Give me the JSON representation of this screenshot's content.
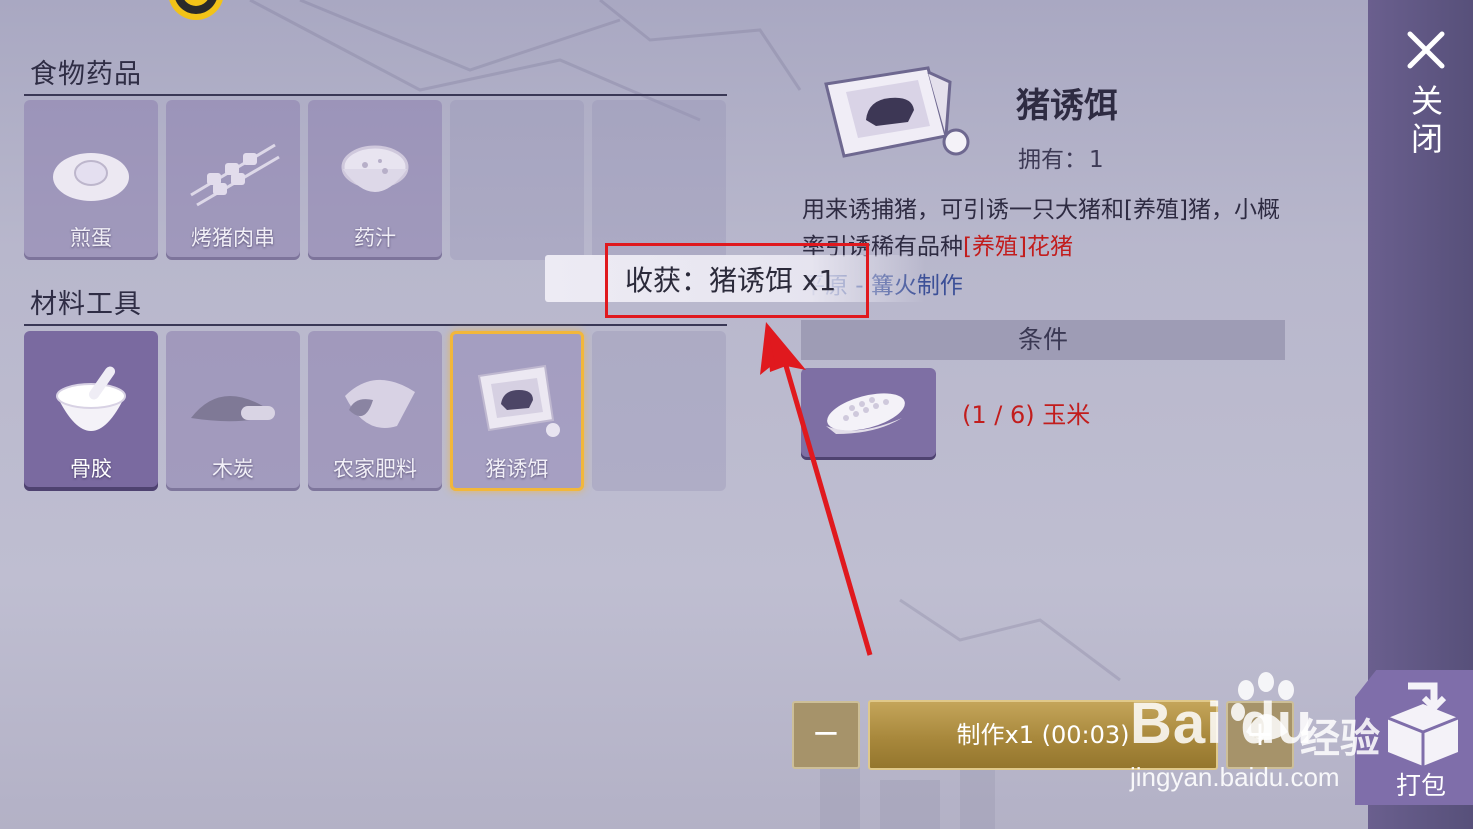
{
  "sections": [
    {
      "title": "食物药品",
      "items": [
        {
          "name": "煎蛋",
          "icon": "fried-egg-icon"
        },
        {
          "name": "烤猪肉串",
          "icon": "pork-skewer-icon"
        },
        {
          "name": "药汁",
          "icon": "soup-bowl-icon"
        },
        {
          "name": "",
          "icon": ""
        },
        {
          "name": "",
          "icon": ""
        }
      ]
    },
    {
      "title": "材料工具",
      "items": [
        {
          "name": "骨胶",
          "icon": "mortar-bowl-icon"
        },
        {
          "name": "木炭",
          "icon": "charcoal-pile-icon"
        },
        {
          "name": "农家肥料",
          "icon": "fertilizer-sack-icon"
        },
        {
          "name": "猪诱饵",
          "icon": "pig-bait-packet-icon",
          "selected": true
        },
        {
          "name": "",
          "icon": ""
        }
      ]
    }
  ],
  "detail": {
    "name": "猪诱饵",
    "owned_label": "拥有：",
    "owned_count": "1",
    "desc_part1": "用来诱捕猪，可引诱一只大猪和[养殖]猪，小概率引诱稀有品种",
    "desc_red": "[养殖]花猪",
    "source": "平原 - 篝火制作",
    "conditions_label": "条件",
    "requirement": "(1 / 6) 玉米",
    "requirement_icon": "corn-icon"
  },
  "controls": {
    "minus_label": "−",
    "craft_label": "制作x1 (00:03)",
    "plus_label": "+"
  },
  "close": {
    "label": "关闭",
    "icon": "close-icon"
  },
  "pack": {
    "label": "打包",
    "icon": "box-icon"
  },
  "toast": {
    "text": "收获：猪诱饵 x1"
  },
  "watermark": {
    "logo": "Bai du",
    "cn": "经验",
    "url": "jingyan.baidu.com"
  },
  "colors": {
    "highlight_red": "#e0191e",
    "selected_gold": "#f2b73a",
    "requirement_red": "#c21d1d"
  }
}
